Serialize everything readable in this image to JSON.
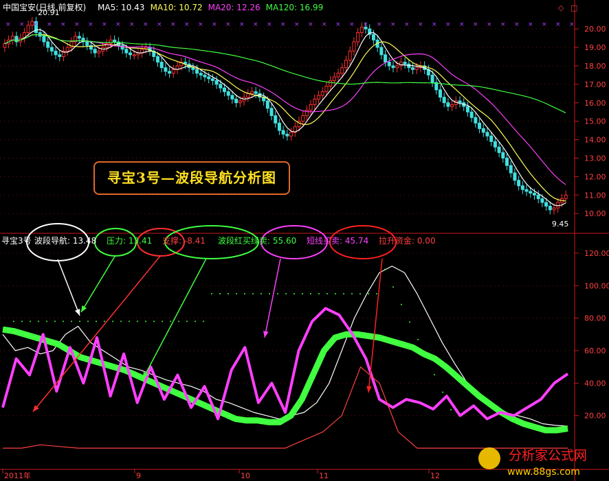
{
  "header": {
    "title": "中国宝安(日线 前复权)",
    "ma": [
      {
        "label": "MA5:",
        "value": "10.43",
        "color": "#ffffff"
      },
      {
        "label": "MA10:",
        "value": "10.72",
        "color": "#ffff55"
      },
      {
        "label": "MA20:",
        "value": "12.26",
        "color": "#ff40ff"
      },
      {
        "label": "MA120:",
        "value": "16.99",
        "color": "#40ff40"
      }
    ]
  },
  "banner": {
    "text": "寻宝3号—波段导航分析图"
  },
  "lower_header": {
    "name": "寻宝3号",
    "items": [
      {
        "label": "波段导航:",
        "value": "13.48",
        "color": "#ffffff"
      },
      {
        "label": "压力:",
        "value": "13.41",
        "color": "#40ff40"
      },
      {
        "label": "支撑:",
        "value": "-8.41",
        "color": "#ff4040"
      },
      {
        "label": "波段红买绿卖:",
        "value": "55.60",
        "color": "#40ff40"
      },
      {
        "label": "短线买卖:",
        "value": "45.74",
        "color": "#ff40ff"
      },
      {
        "label": "拉升资金:",
        "value": "0.00",
        "color": "#ff4040"
      }
    ]
  },
  "x_axis": {
    "labels": [
      "2011年",
      "9",
      "10",
      "11",
      "12"
    ]
  },
  "watermark": {
    "text": "分析家公式网",
    "url": "www.88gs.com"
  },
  "chart_data": [
    {
      "type": "candlestick",
      "title": "中国宝安(日线 前复权)",
      "ylim": [
        9.3,
        20.6
      ],
      "y_ticks": [
        10.0,
        11.0,
        12.0,
        13.0,
        14.0,
        15.0,
        16.0,
        17.0,
        18.0,
        19.0,
        20.0
      ],
      "annotations": [
        {
          "text": "20.91",
          "x_index": 6,
          "y": 20.9
        },
        {
          "text": "9.45",
          "x_index": 137,
          "y": 9.45
        }
      ],
      "candles_close": [
        19.2,
        19.4,
        19.6,
        19.3,
        19.5,
        19.8,
        20.2,
        20.4,
        19.8,
        19.6,
        19.3,
        19.0,
        18.8,
        18.6,
        18.5,
        18.8,
        19.0,
        19.3,
        19.6,
        19.5,
        19.3,
        19.1,
        18.9,
        18.7,
        18.8,
        19.0,
        19.2,
        19.4,
        19.3,
        19.1,
        18.9,
        18.7,
        18.6,
        18.6,
        18.7,
        18.9,
        19.0,
        18.8,
        18.5,
        18.2,
        17.9,
        17.7,
        17.6,
        17.8,
        18.0,
        18.2,
        18.1,
        17.9,
        17.8,
        17.6,
        17.5,
        17.4,
        17.3,
        17.2,
        17.0,
        16.8,
        16.6,
        16.4,
        16.2,
        16.0,
        16.1,
        16.3,
        16.5,
        16.6,
        16.5,
        16.3,
        16.1,
        15.7,
        15.3,
        14.9,
        14.5,
        14.3,
        14.2,
        14.4,
        14.7,
        15.0,
        15.3,
        15.6,
        15.9,
        16.2,
        16.4,
        16.6,
        16.9,
        17.2,
        17.4,
        17.6,
        17.9,
        18.3,
        18.8,
        19.3,
        19.8,
        20.1,
        20.0,
        19.7,
        19.4,
        19.0,
        18.6,
        18.2,
        18.0,
        17.9,
        18.0,
        18.2,
        18.1,
        17.9,
        17.8,
        17.9,
        18.0,
        17.8,
        17.5,
        17.1,
        16.7,
        16.3,
        16.0,
        15.8,
        15.9,
        16.1,
        16.0,
        15.8,
        15.5,
        15.2,
        14.9,
        14.6,
        14.4,
        14.2,
        13.9,
        13.6,
        13.3,
        13.0,
        12.6,
        12.2,
        11.8,
        11.5,
        11.3,
        11.2,
        11.1,
        11.0,
        10.8,
        10.6,
        10.4,
        10.2,
        10.3,
        10.6,
        10.8,
        11.0
      ],
      "series": [
        {
          "name": "MA5",
          "color": "#ffffff",
          "values": [
            19.6,
            10.43
          ]
        },
        {
          "name": "MA10",
          "color": "#ffff55",
          "values": [
            19.5,
            10.72
          ]
        },
        {
          "name": "MA20",
          "color": "#ff40ff",
          "values": [
            19.3,
            12.26
          ]
        },
        {
          "name": "MA120",
          "color": "#40ff40",
          "values": [
            18.9,
            16.99
          ]
        }
      ]
    },
    {
      "type": "line",
      "title": "寻宝3号",
      "ylim": [
        -8,
        128
      ],
      "y_ticks": [
        20.0,
        40.0,
        60.0,
        80.0,
        100.0,
        120.0
      ],
      "series": [
        {
          "name": "波段导航",
          "color": "#ffffff",
          "values": [
            70,
            60,
            62,
            58,
            60,
            70,
            75,
            65,
            60,
            55,
            50,
            48,
            45,
            42,
            40,
            38,
            35,
            30,
            28,
            25,
            22,
            20,
            18,
            20,
            22,
            28,
            40,
            60,
            80,
            95,
            108,
            112,
            108,
            95,
            80,
            65,
            52,
            40,
            30,
            25,
            22,
            20,
            18,
            15,
            14,
            13.48
          ]
        },
        {
          "name": "波段红买绿卖",
          "color": "#40ff40",
          "values": [
            73,
            72,
            70,
            68,
            66,
            64,
            60,
            56,
            54,
            52,
            50,
            48,
            45,
            42,
            39,
            36,
            33,
            30,
            27,
            24,
            21,
            18,
            17,
            17,
            16,
            16,
            20,
            30,
            45,
            60,
            68,
            70,
            70,
            69,
            68,
            66,
            64,
            62,
            58,
            55,
            50,
            44,
            38,
            32,
            27,
            22,
            18,
            15,
            13,
            11,
            11,
            12
          ]
        },
        {
          "name": "短线买卖",
          "color": "#ff40ff",
          "values": [
            25,
            55,
            45,
            70,
            35,
            62,
            40,
            68,
            32,
            58,
            28,
            50,
            30,
            45,
            25,
            38,
            18,
            48,
            62,
            28,
            40,
            22,
            60,
            78,
            86,
            82,
            70,
            55,
            30,
            25,
            30,
            28,
            24,
            32,
            20,
            26,
            18,
            22,
            20,
            25,
            30,
            40,
            45.74
          ]
        },
        {
          "name": "拉升资金",
          "color": "#ff4040",
          "values": [
            0,
            0,
            2,
            1,
            0,
            0,
            0,
            0,
            0,
            0,
            0,
            0,
            0,
            0,
            0,
            0,
            5,
            10,
            20,
            50,
            40,
            10,
            0,
            0,
            0,
            0,
            0,
            0,
            0,
            0,
            0
          ]
        }
      ]
    }
  ]
}
